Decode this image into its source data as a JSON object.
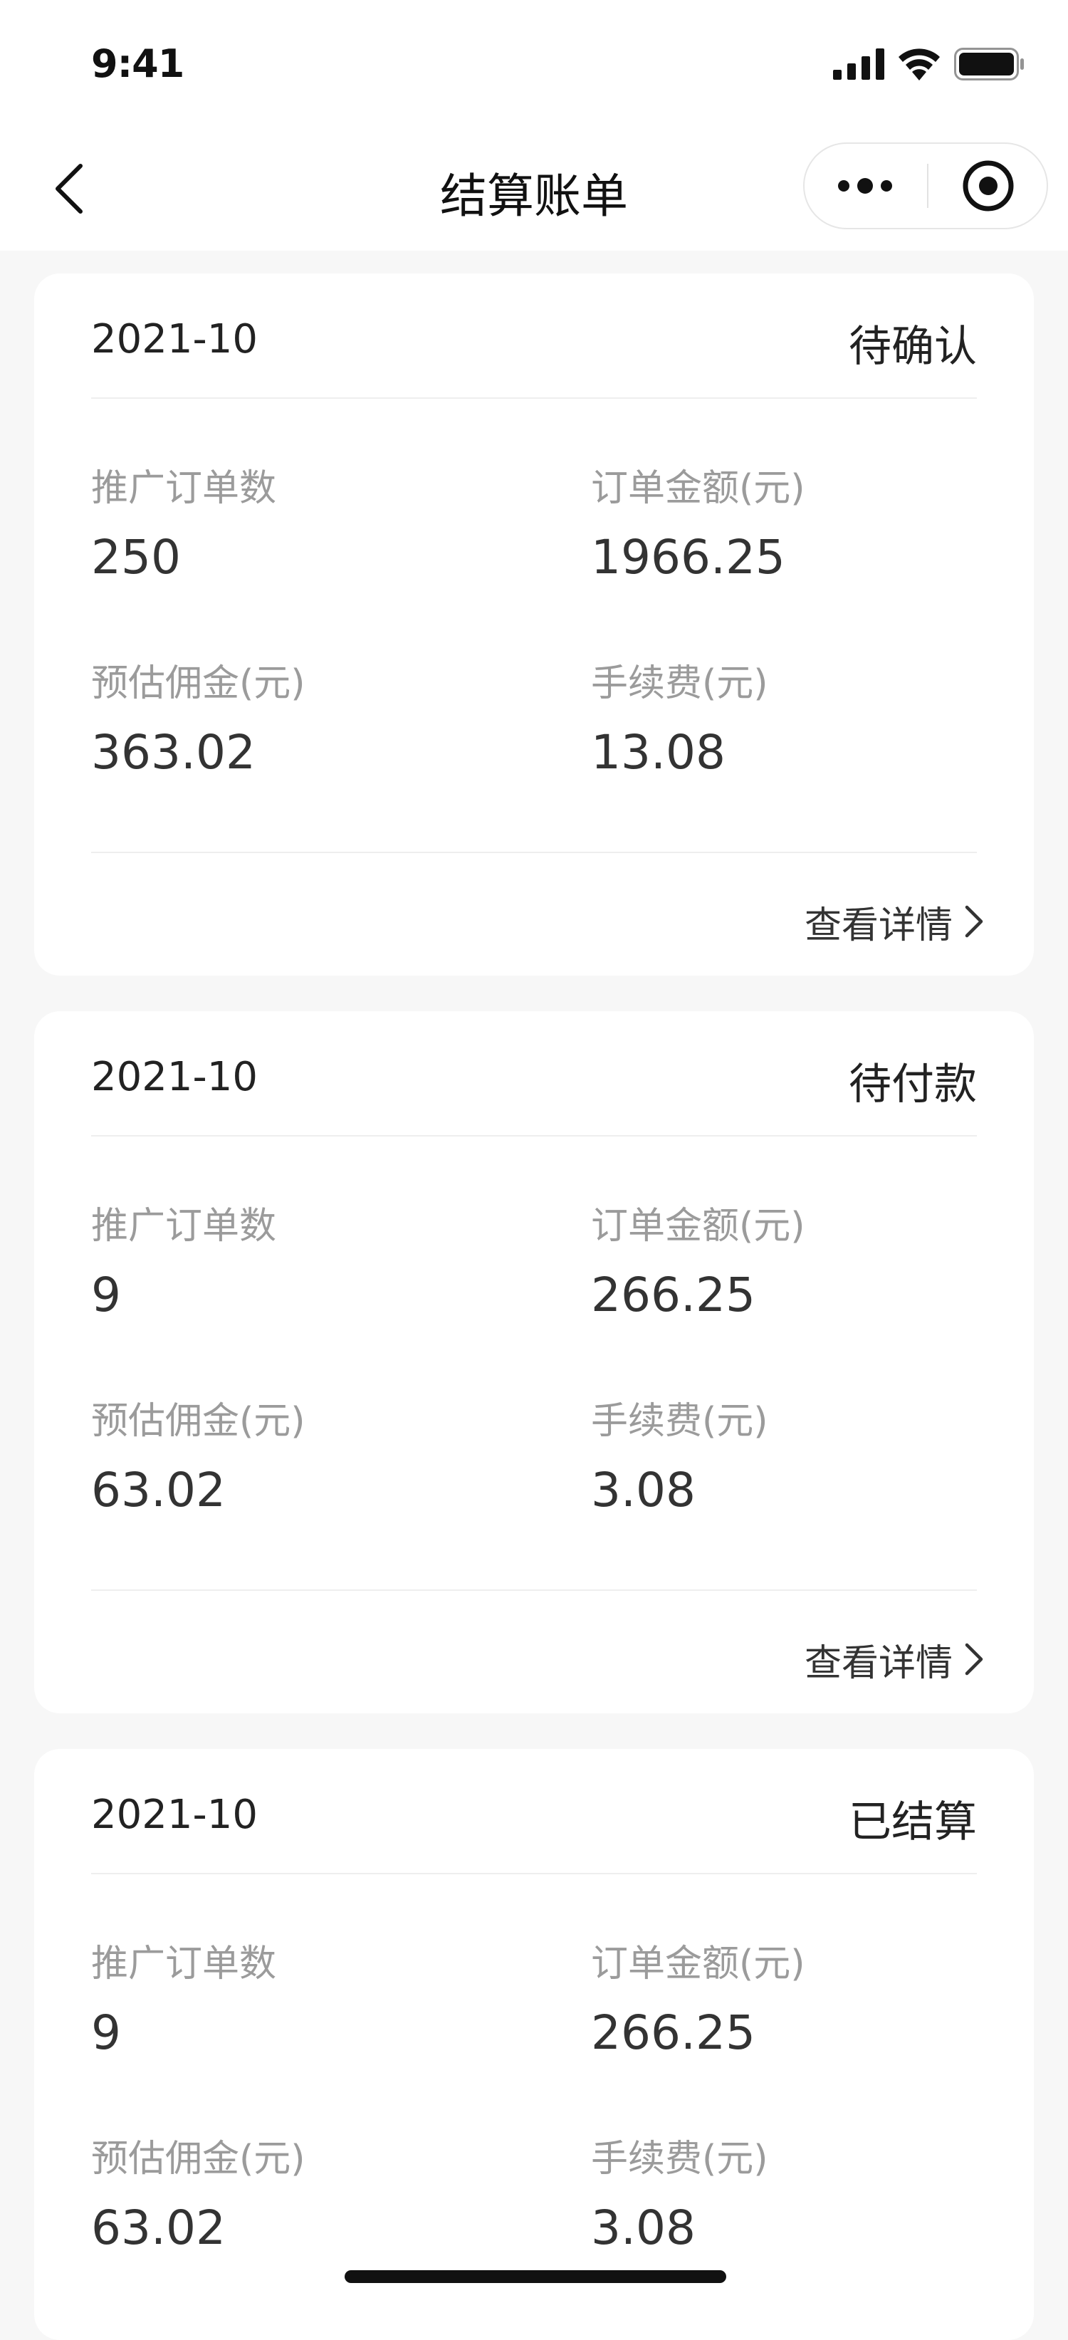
{
  "status_bar": {
    "time": "9:41"
  },
  "nav": {
    "title": "结算账单"
  },
  "labels": {
    "orders": "推广订单数",
    "amount": "订单金额(元)",
    "commission": "预估佣金(元)",
    "fee": "手续费(元)",
    "detail": "查看详情"
  },
  "bills": [
    {
      "month": "2021-10",
      "status": "待确认",
      "orders": "250",
      "amount": "1966.25",
      "commission": "363.02",
      "fee": "13.08"
    },
    {
      "month": "2021-10",
      "status": "待付款",
      "orders": "9",
      "amount": "266.25",
      "commission": "63.02",
      "fee": "3.08"
    },
    {
      "month": "2021-10",
      "status": "已结算",
      "orders": "9",
      "amount": "266.25",
      "commission": "63.02",
      "fee": "3.08"
    }
  ]
}
